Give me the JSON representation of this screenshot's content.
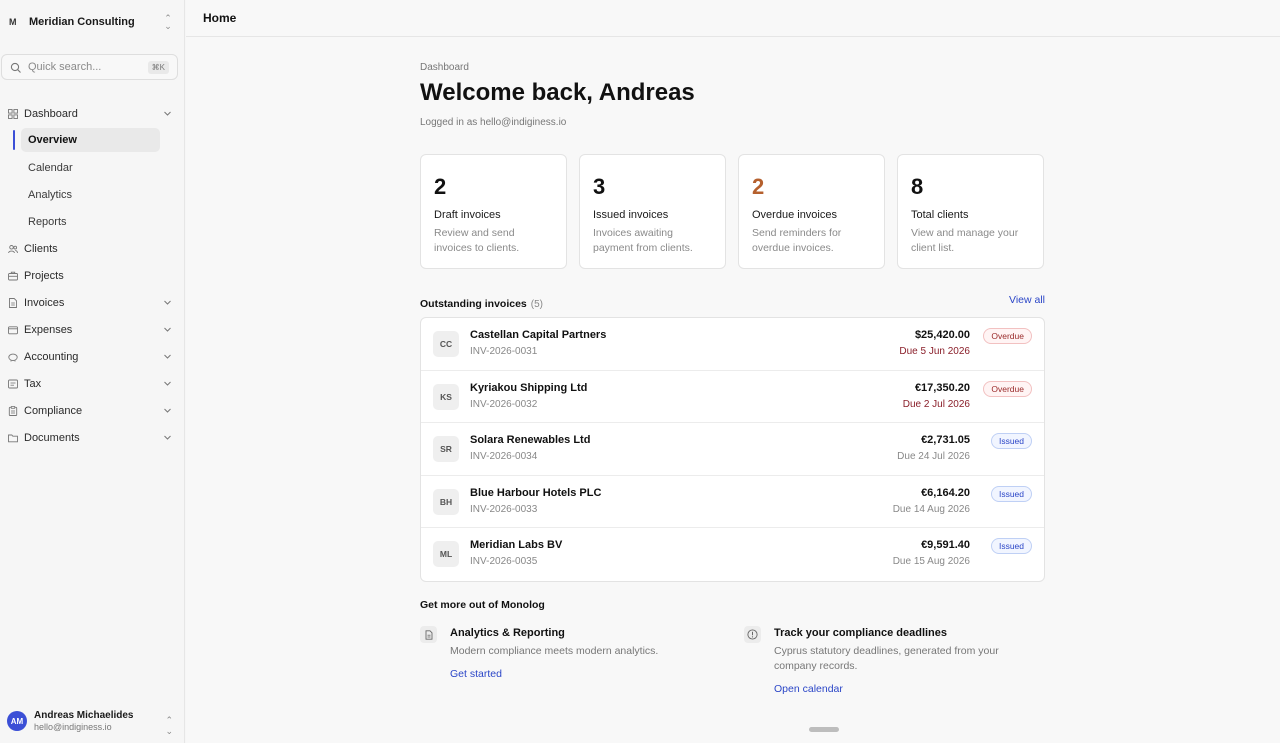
{
  "org": {
    "mark": "M",
    "name": "Meridian Consulting"
  },
  "search": {
    "placeholder": "Quick search...",
    "shortcut": "⌘K"
  },
  "nav": {
    "dashboard": {
      "label": "Dashboard",
      "icon": "grid-icon"
    },
    "sub": [
      "Overview",
      "Calendar",
      "Analytics",
      "Reports"
    ],
    "items": [
      {
        "label": "Clients",
        "icon": "users-icon",
        "expandable": false
      },
      {
        "label": "Projects",
        "icon": "briefcase-icon",
        "expandable": false
      },
      {
        "label": "Invoices",
        "icon": "file-icon",
        "expandable": true
      },
      {
        "label": "Expenses",
        "icon": "wallet-icon",
        "expandable": true
      },
      {
        "label": "Accounting",
        "icon": "piggy-bank-icon",
        "expandable": true
      },
      {
        "label": "Tax",
        "icon": "receipt-icon",
        "expandable": true
      },
      {
        "label": "Compliance",
        "icon": "clipboard-icon",
        "expandable": true
      },
      {
        "label": "Documents",
        "icon": "folder-icon",
        "expandable": true
      }
    ]
  },
  "user": {
    "initials": "AM",
    "name": "Andreas Michaelides",
    "email": "hello@indiginess.io"
  },
  "topbar": {
    "crumb": "Home"
  },
  "page": {
    "eyebrow": "Dashboard",
    "title": "Welcome back, Andreas",
    "logged_in": "Logged in as hello@indiginess.io"
  },
  "stats": [
    {
      "value": "2",
      "title": "Draft invoices",
      "desc": "Review and send invoices to clients."
    },
    {
      "value": "3",
      "title": "Issued invoices",
      "desc": "Invoices awaiting payment from clients."
    },
    {
      "value": "2",
      "title": "Overdue invoices",
      "desc": "Send reminders for overdue invoices."
    },
    {
      "value": "8",
      "title": "Total clients",
      "desc": "View and manage your client list."
    }
  ],
  "outstanding": {
    "title": "Outstanding invoices",
    "count": "(5)",
    "view_all": "View all",
    "rows": [
      {
        "initials": "CC",
        "client": "Castellan Capital Partners",
        "number": "INV-2026-0031",
        "amount": "$25,420.00",
        "due": "Due 5 Jun 2026",
        "status": "Overdue"
      },
      {
        "initials": "KS",
        "client": "Kyriakou Shipping Ltd",
        "number": "INV-2026-0032",
        "amount": "€17,350.20",
        "due": "Due 2 Jul 2026",
        "status": "Overdue"
      },
      {
        "initials": "SR",
        "client": "Solara Renewables Ltd",
        "number": "INV-2026-0034",
        "amount": "€2,731.05",
        "due": "Due 24 Jul 2026",
        "status": "Issued"
      },
      {
        "initials": "BH",
        "client": "Blue Harbour Hotels PLC",
        "number": "INV-2026-0033",
        "amount": "€6,164.20",
        "due": "Due 14 Aug 2026",
        "status": "Issued"
      },
      {
        "initials": "ML",
        "client": "Meridian Labs BV",
        "number": "INV-2026-0035",
        "amount": "€9,591.40",
        "due": "Due 15 Aug 2026",
        "status": "Issued"
      }
    ]
  },
  "more": {
    "title": "Get more out of Monolog",
    "tips": [
      {
        "icon": "document-icon",
        "title": "Analytics & Reporting",
        "desc": "Modern compliance meets modern analytics.",
        "link": "Get started"
      },
      {
        "icon": "info-icon",
        "title": "Track your compliance deadlines",
        "desc": "Cyprus statutory deadlines, generated from your company records.",
        "link": "Open calendar"
      }
    ]
  },
  "colors": {
    "accent": "#3b4fd6",
    "link": "#2b46c7",
    "overdue_text": "#8a1f2a",
    "overdue_count": "#b5602e"
  }
}
